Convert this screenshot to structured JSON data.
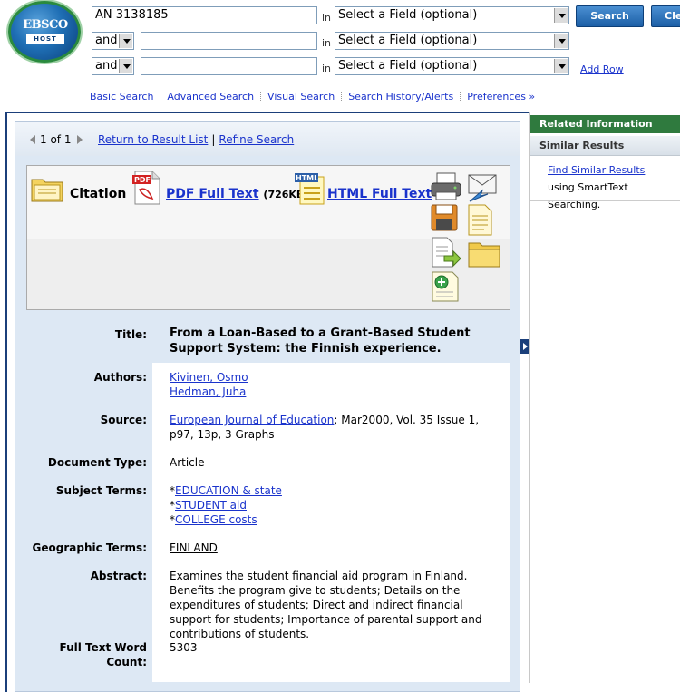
{
  "logo": {
    "brand": "EBSCO",
    "sub": "HOST"
  },
  "search": {
    "rows": [
      {
        "bool": "",
        "term": "AN 3138185",
        "in_label": "in",
        "field": "Select a Field (optional)"
      },
      {
        "bool": "and",
        "term": "",
        "in_label": "in",
        "field": "Select a Field (optional)"
      },
      {
        "bool": "and",
        "term": "",
        "in_label": "in",
        "field": "Select a Field (optional)"
      }
    ],
    "search_button": "Search",
    "clear_button": "Cle",
    "add_row": "Add Row"
  },
  "top_links": [
    "Basic Search",
    "Advanced Search",
    "Visual Search",
    "Search History/Alerts",
    "Preferences »"
  ],
  "nav": {
    "count": "1 of 1",
    "return_link": "Return to Result List",
    "separator": "|",
    "refine_link": "Refine Search"
  },
  "formats": {
    "citation": "Citation",
    "pdf": "PDF Full Text",
    "pdf_size": "(726KB)",
    "html": "HTML Full Text"
  },
  "record": {
    "title_label": "Title:",
    "title": "From a Loan-Based to a Grant-Based Student Support System: the Finnish experience.",
    "authors_label": "Authors:",
    "authors": [
      "Kivinen, Osmo",
      "Hedman, Juha"
    ],
    "source_label": "Source:",
    "source_journal": "European Journal of Education",
    "source_rest": "; Mar2000, Vol. 35 Issue 1, p97, 13p, 3 Graphs",
    "doctype_label": "Document Type:",
    "doctype": "Article",
    "subjects_label": "Subject Terms:",
    "subject_prefix": "*",
    "subjects": [
      "EDUCATION & state",
      "STUDENT aid",
      "COLLEGE costs"
    ],
    "geo_label": "Geographic Terms:",
    "geo": "FINLAND",
    "abstract_label": "Abstract:",
    "abstract": "Examines the student financial aid program in Finland. Benefits the program give to students; Details on the expenditures of students; Direct and indirect financial support for students; Importance of parental support and contributions of students.",
    "wordcount_label": "Full Text Word Count:",
    "wordcount": "5303"
  },
  "sidebar": {
    "related_header": "Related Information",
    "similar_header": "Similar Results",
    "find_similar": "Find Similar Results",
    "find_similar_rest": " using SmartText Searching."
  }
}
